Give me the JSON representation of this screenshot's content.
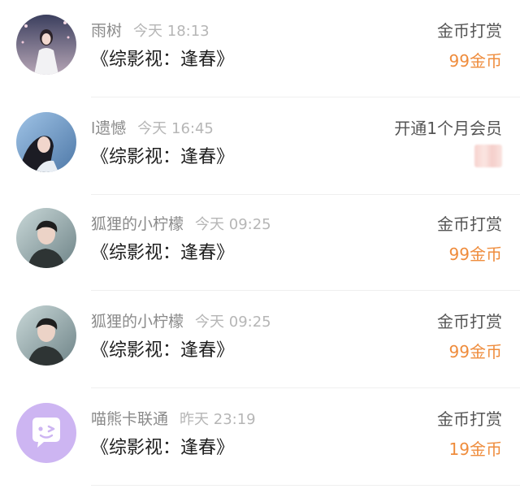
{
  "records": [
    {
      "user": "雨树",
      "time": "今天 18:13",
      "title": "《综影视：逢春》",
      "type": "金币打赏",
      "amount": "99金币",
      "avatar_icon": "user-avatar-photo"
    },
    {
      "user": "l遗憾",
      "time": "今天 16:45",
      "title": "《综影视：逢春》",
      "type": "开通1个月会员",
      "amount": "",
      "amount_obscured": true,
      "avatar_icon": "user-avatar-photo"
    },
    {
      "user": "狐狸的小柠檬",
      "time": "今天 09:25",
      "title": "《综影视：逢春》",
      "type": "金币打赏",
      "amount": "99金币",
      "avatar_icon": "user-avatar-photo"
    },
    {
      "user": "狐狸的小柠檬",
      "time": "今天 09:25",
      "title": "《综影视：逢春》",
      "type": "金币打赏",
      "amount": "99金币",
      "avatar_icon": "user-avatar-photo"
    },
    {
      "user": "喵熊卡联通",
      "time": "昨天 23:19",
      "title": "《综影视：逢春》",
      "type": "金币打赏",
      "amount": "19金币",
      "avatar_icon": "default-chat-bubble-avatar"
    }
  ],
  "colors": {
    "amount": "#ef8c3c",
    "username": "#8a8a8a",
    "timestamp": "#b6b6b6",
    "title": "#1f1f1f",
    "type": "#555555",
    "default_avatar_bg": "#cdb5f2"
  }
}
